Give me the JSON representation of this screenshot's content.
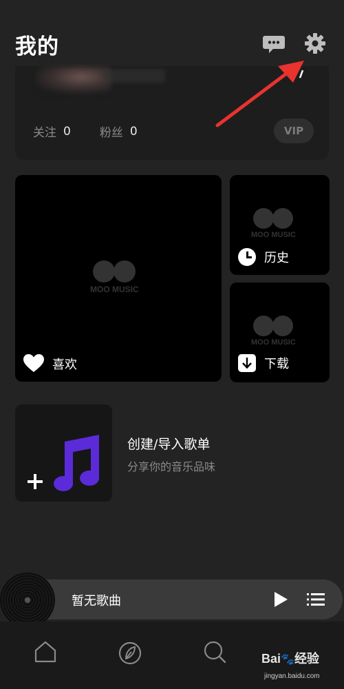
{
  "header": {
    "title": "我的",
    "messages_icon": "chat-bubble-icon",
    "settings_icon": "gear-icon"
  },
  "profile": {
    "following_label": "关注",
    "following_count": "0",
    "fans_label": "粉丝",
    "fans_count": "0",
    "vip_label": "VIP"
  },
  "tiles": {
    "favorites_label": "喜欢",
    "history_label": "历史",
    "downloads_label": "下载",
    "placeholder_logo_text": "MOO MUSIC"
  },
  "playlist": {
    "create_title": "创建/导入歌单",
    "create_subtitle": "分享你的音乐品味"
  },
  "player": {
    "title": "暂无歌曲"
  },
  "nav": {
    "items": [
      "home-icon",
      "leaf-icon",
      "search-icon"
    ]
  },
  "watermark": {
    "brand": "Bai",
    "brand2": "经验",
    "url": "jingyan.baidu.com"
  },
  "colors": {
    "accent_note": "#5b2bd9",
    "arrow": "#e8332f",
    "background": "#232323"
  }
}
